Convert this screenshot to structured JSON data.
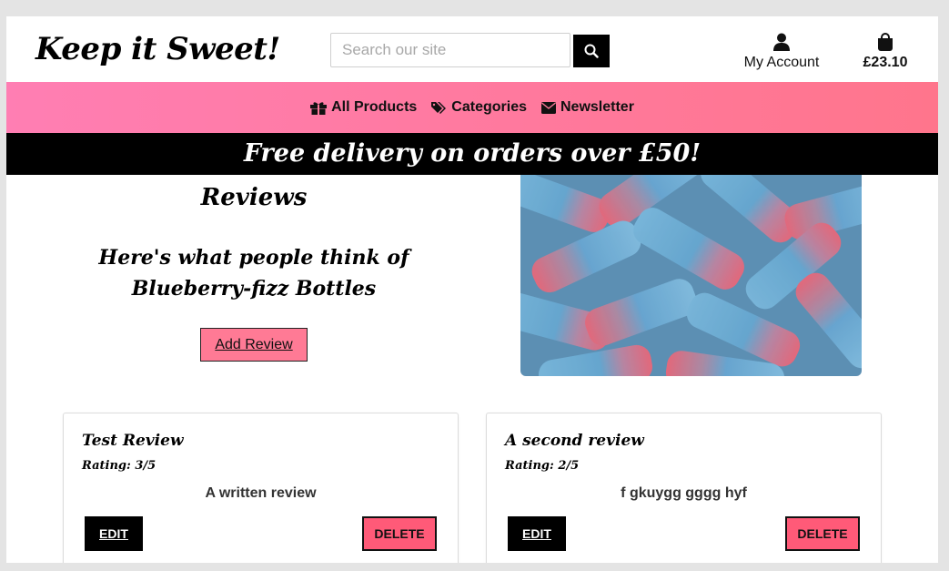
{
  "header": {
    "logo_text": "Keep it Sweet!",
    "search_placeholder": "Search our site",
    "account_label": "My Account",
    "bag_total": "£23.10"
  },
  "nav": {
    "items": [
      {
        "label": "All Products",
        "icon": "gift-icon"
      },
      {
        "label": "Categories",
        "icon": "tags-icon"
      },
      {
        "label": "Newsletter",
        "icon": "envelope-icon"
      }
    ]
  },
  "banner": {
    "text": "Free delivery on orders over £50!"
  },
  "main": {
    "heading": "Reviews",
    "subheading": "Here's what people think of Blueberry-fizz Bottles",
    "add_review_label": "Add Review",
    "product_image_alt": "blueberry-fizz-bottles-image"
  },
  "reviews": [
    {
      "title": "Test Review",
      "rating": "Rating: 3/5",
      "text": "A written review",
      "edit_label": "EDIT",
      "delete_label": "DELETE"
    },
    {
      "title": "A second review",
      "rating": "Rating: 2/5",
      "text": "f gkuygg gggg hyf",
      "edit_label": "EDIT",
      "delete_label": "DELETE"
    }
  ],
  "colors": {
    "nav_gradient_start": "#ff7eb3",
    "nav_gradient_end": "#ff758c",
    "add_review_bg": "#ff7a95",
    "delete_bg": "#ff5a78",
    "banner_bg": "#000000"
  }
}
